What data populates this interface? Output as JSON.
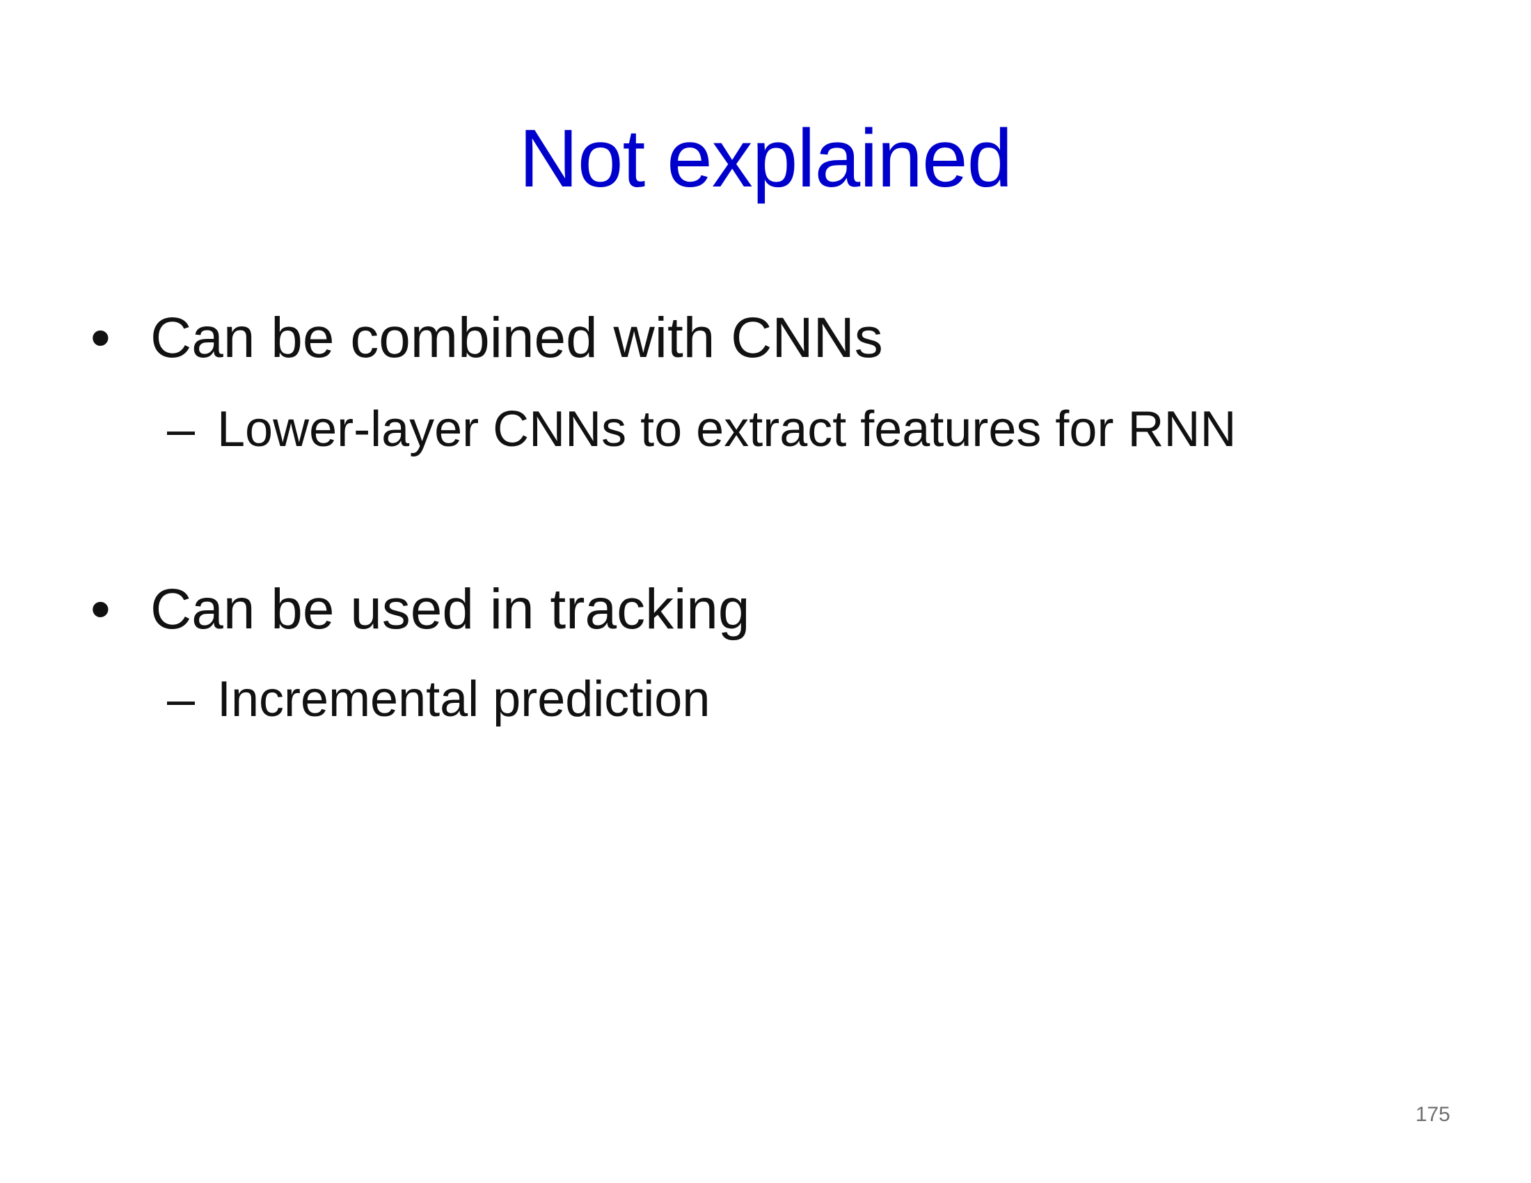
{
  "slide": {
    "title": "Not explained",
    "bullets": [
      {
        "marker": "•",
        "text": "Can be combined with CNNs",
        "sub": {
          "marker": "–",
          "text": "Lower-layer CNNs to extract features for RNN"
        }
      },
      {
        "marker": "•",
        "text": "Can be used in tracking",
        "sub": {
          "marker": "–",
          "text": "Incremental prediction"
        }
      }
    ],
    "page_number": "175"
  },
  "colors": {
    "title": "#0000CC",
    "body_text": "#111111",
    "page_number": "#6f6f6f",
    "background": "#ffffff"
  }
}
